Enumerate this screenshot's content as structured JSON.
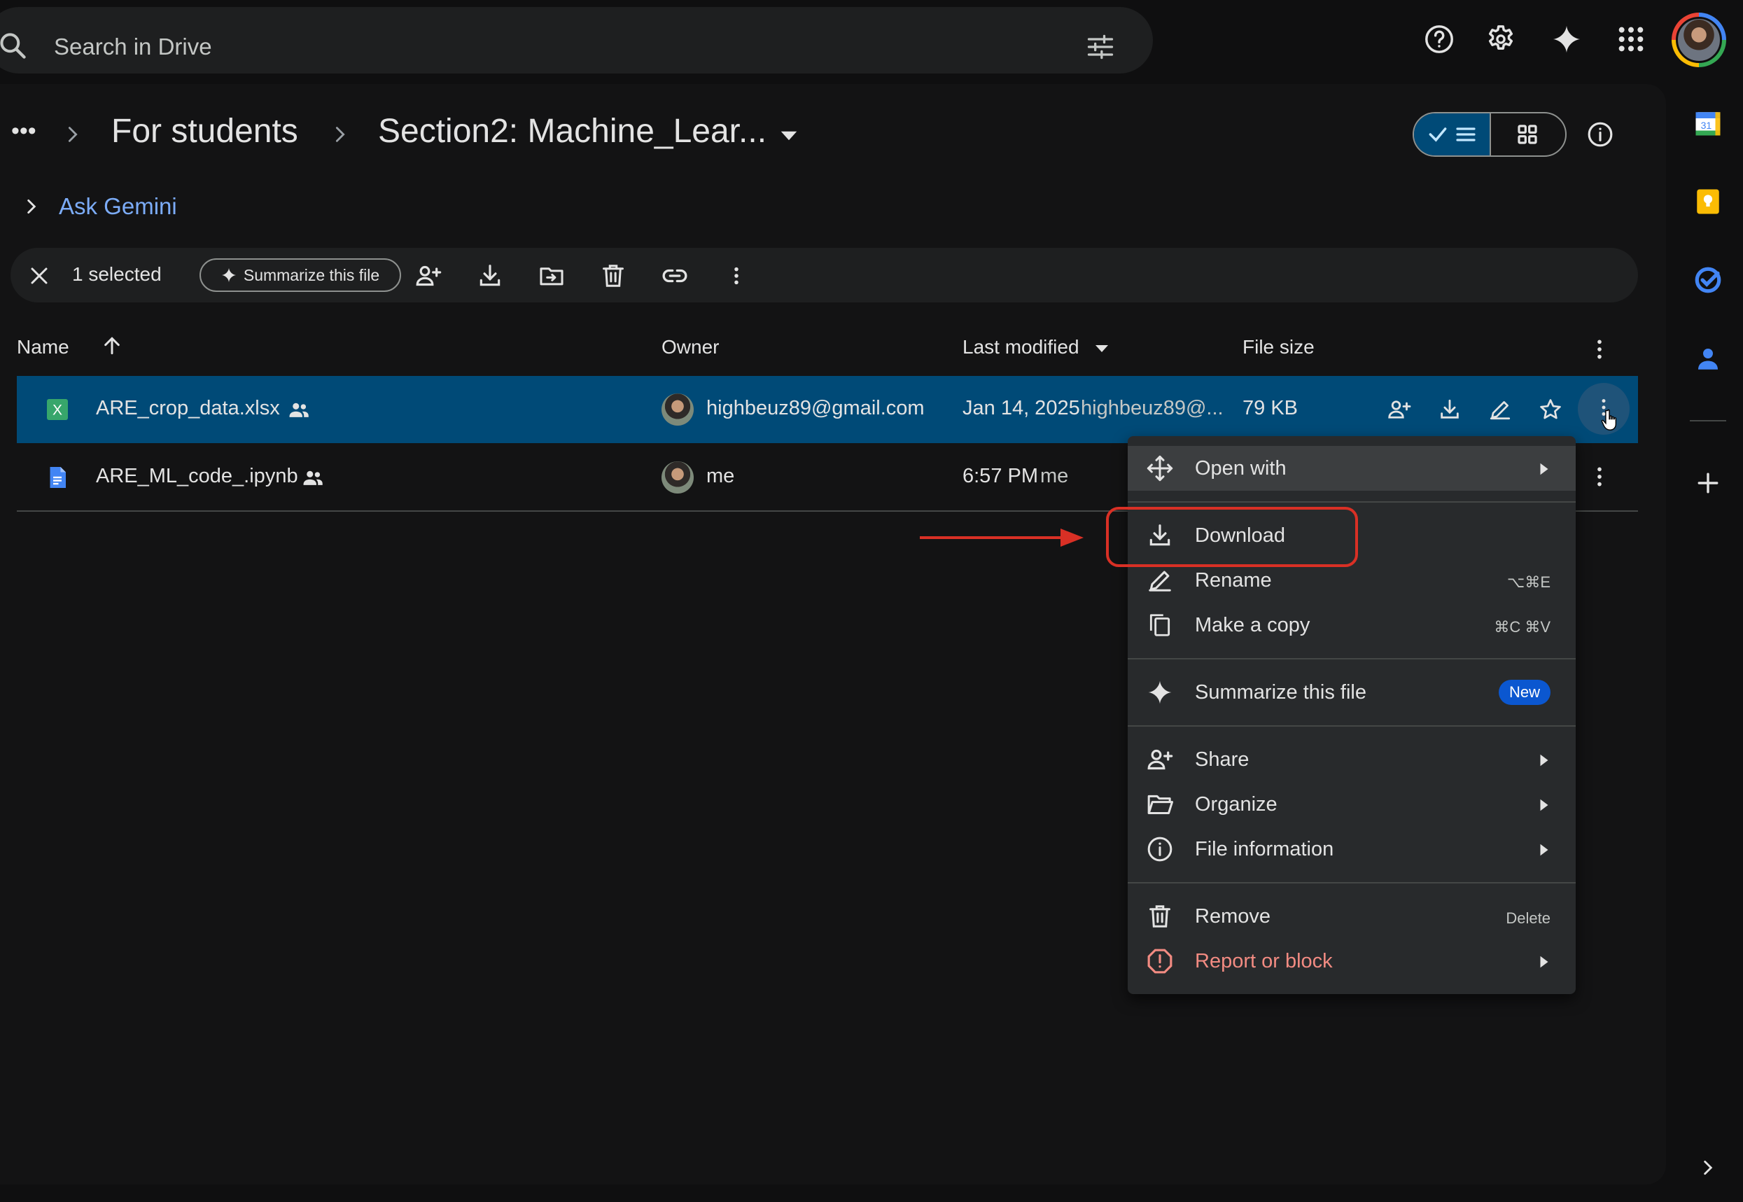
{
  "search": {
    "placeholder": "Search in Drive"
  },
  "breadcrumb": {
    "more": "•••",
    "parent": "For students",
    "current": "Section2: Machine_Lear..."
  },
  "ask_gemini": "Ask Gemini",
  "selection_bar": {
    "count": "1 selected",
    "summarize": "Summarize this file"
  },
  "table": {
    "headers": {
      "name": "Name",
      "owner": "Owner",
      "modified": "Last modified",
      "size": "File size"
    },
    "rows": [
      {
        "name": "ARE_crop_data.xlsx",
        "owner": "highbeuz89@gmail.com",
        "modified_date": "Jan 14, 2025",
        "modified_by": "highbeuz89@...",
        "size": "79 KB"
      },
      {
        "name": "ARE_ML_code_.ipynb",
        "owner": "me",
        "modified_date": "6:57 PM",
        "modified_by": "me",
        "size": ""
      }
    ]
  },
  "context_menu": {
    "open_with": "Open with",
    "download": "Download",
    "rename": "Rename",
    "rename_shortcut": "⌥⌘E",
    "make_copy": "Make a copy",
    "make_copy_shortcut": "⌘C ⌘V",
    "summarize": "Summarize this file",
    "new_badge": "New",
    "share": "Share",
    "organize": "Organize",
    "file_info": "File information",
    "remove": "Remove",
    "remove_shortcut": "Delete",
    "report": "Report or block"
  },
  "icons": {
    "search": "search-icon",
    "filter": "tune-icon",
    "help": "help-icon",
    "settings": "gear-icon",
    "gemini": "sparkle-icon",
    "apps": "apps-grid-icon",
    "calendar": "calendar-icon",
    "keep": "keep-icon",
    "tasks": "tasks-icon",
    "contacts": "contacts-icon"
  },
  "colors": {
    "background": "#131314",
    "selected_row": "#004a77",
    "accent_link": "#7cacf8",
    "annotation": "#d93025",
    "report_text": "#f28b82",
    "new_badge": "#0b57d0"
  },
  "side_panel": {
    "calendar_day": "31"
  }
}
